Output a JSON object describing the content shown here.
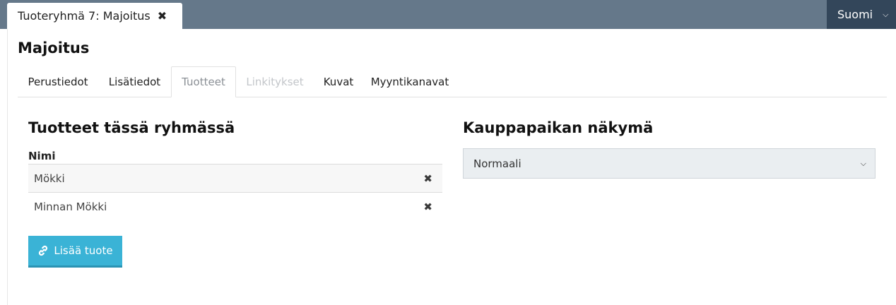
{
  "header": {
    "doc_tab_label": "Tuoteryhmä 7: Majoitus",
    "doc_tab_close": "✖",
    "language": "Suomi",
    "language_chevron": "⌄"
  },
  "page_title": "Majoitus",
  "tabs": [
    {
      "label": "Perustiedot",
      "state": "normal"
    },
    {
      "label": "Lisätiedot",
      "state": "normal"
    },
    {
      "label": "Tuotteet",
      "state": "active"
    },
    {
      "label": "Linkitykset",
      "state": "disabled"
    },
    {
      "label": "Kuvat",
      "state": "normal"
    },
    {
      "label": "Myyntikanavat",
      "state": "normal"
    }
  ],
  "products": {
    "title": "Tuotteet tässä ryhmässä",
    "column_header": "Nimi",
    "rows": [
      {
        "name": "Mökki",
        "remove": "✖"
      },
      {
        "name": "Minnan Mökki",
        "remove": "✖"
      }
    ],
    "add_button": "Lisää tuote",
    "add_button_icon": "link-icon"
  },
  "marketplace": {
    "title": "Kauppapaikan näkymä",
    "selected": "Normaali",
    "chevron": "⌄"
  },
  "colors": {
    "topbar": "#65788a",
    "language_bg": "#33465a",
    "accent_button": "#3ab3d6"
  }
}
